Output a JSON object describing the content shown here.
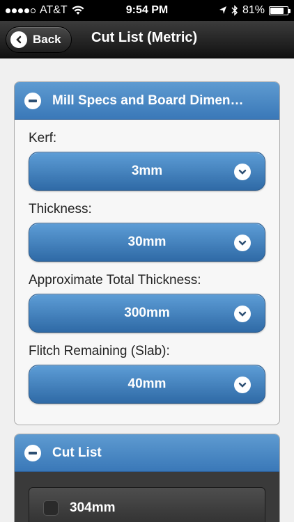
{
  "status": {
    "carrier": "AT&T",
    "time": "9:54 PM",
    "battery": "81%",
    "battery_level": 0.81
  },
  "header": {
    "back_label": "Back",
    "title": "Cut List (Metric)"
  },
  "mill_specs": {
    "title": "Mill Specs and Board Dimen…",
    "fields": [
      {
        "label": "Kerf:",
        "value": "3mm"
      },
      {
        "label": "Thickness:",
        "value": "30mm"
      },
      {
        "label": "Approximate Total Thickness:",
        "value": "300mm"
      },
      {
        "label": "Flitch Remaining (Slab):",
        "value": "40mm"
      }
    ]
  },
  "cut_list": {
    "title": "Cut List",
    "items": [
      {
        "label": "304mm"
      }
    ]
  }
}
